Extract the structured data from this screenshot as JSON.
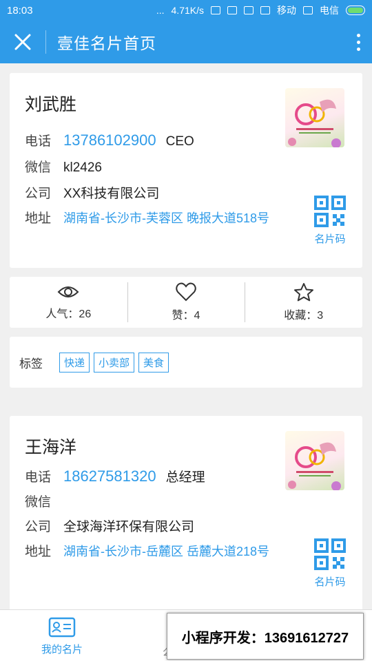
{
  "status_bar": {
    "time": "18:03",
    "speed": "4.71K/s",
    "carrier1": "移动",
    "carrier2": "电信",
    "dots": "..."
  },
  "header": {
    "title": "壹佳名片首页"
  },
  "cards": [
    {
      "name": "刘武胜",
      "phone_label": "电话",
      "phone": "13786102900",
      "position": "CEO",
      "wechat_label": "微信",
      "wechat": "kl2426",
      "company_label": "公司",
      "company": "XX科技有限公司",
      "address_label": "地址",
      "address": "湖南省-长沙市-芙蓉区 晚报大道518号",
      "qr_label": "名片码"
    },
    {
      "name": "王海洋",
      "phone_label": "电话",
      "phone": "18627581320",
      "position": "总经理",
      "wechat_label": "微信",
      "wechat": "",
      "company_label": "公司",
      "company": "全球海洋环保有限公司",
      "address_label": "地址",
      "address": "湖南省-长沙市-岳麓区 岳麓大道218号",
      "qr_label": "名片码"
    }
  ],
  "stats": {
    "views": "人气：26",
    "likes": "赞：4",
    "favorites": "收藏：3"
  },
  "tags": {
    "label": "标签",
    "items": [
      "快递",
      "小卖部",
      "美食"
    ]
  },
  "tabbar": {
    "my_card": "我的名片",
    "fragment": "么"
  },
  "promo": {
    "text": "小程序开发：13691612727"
  },
  "colors": {
    "accent": "#2f9be8",
    "background": "#f0f0f0"
  }
}
